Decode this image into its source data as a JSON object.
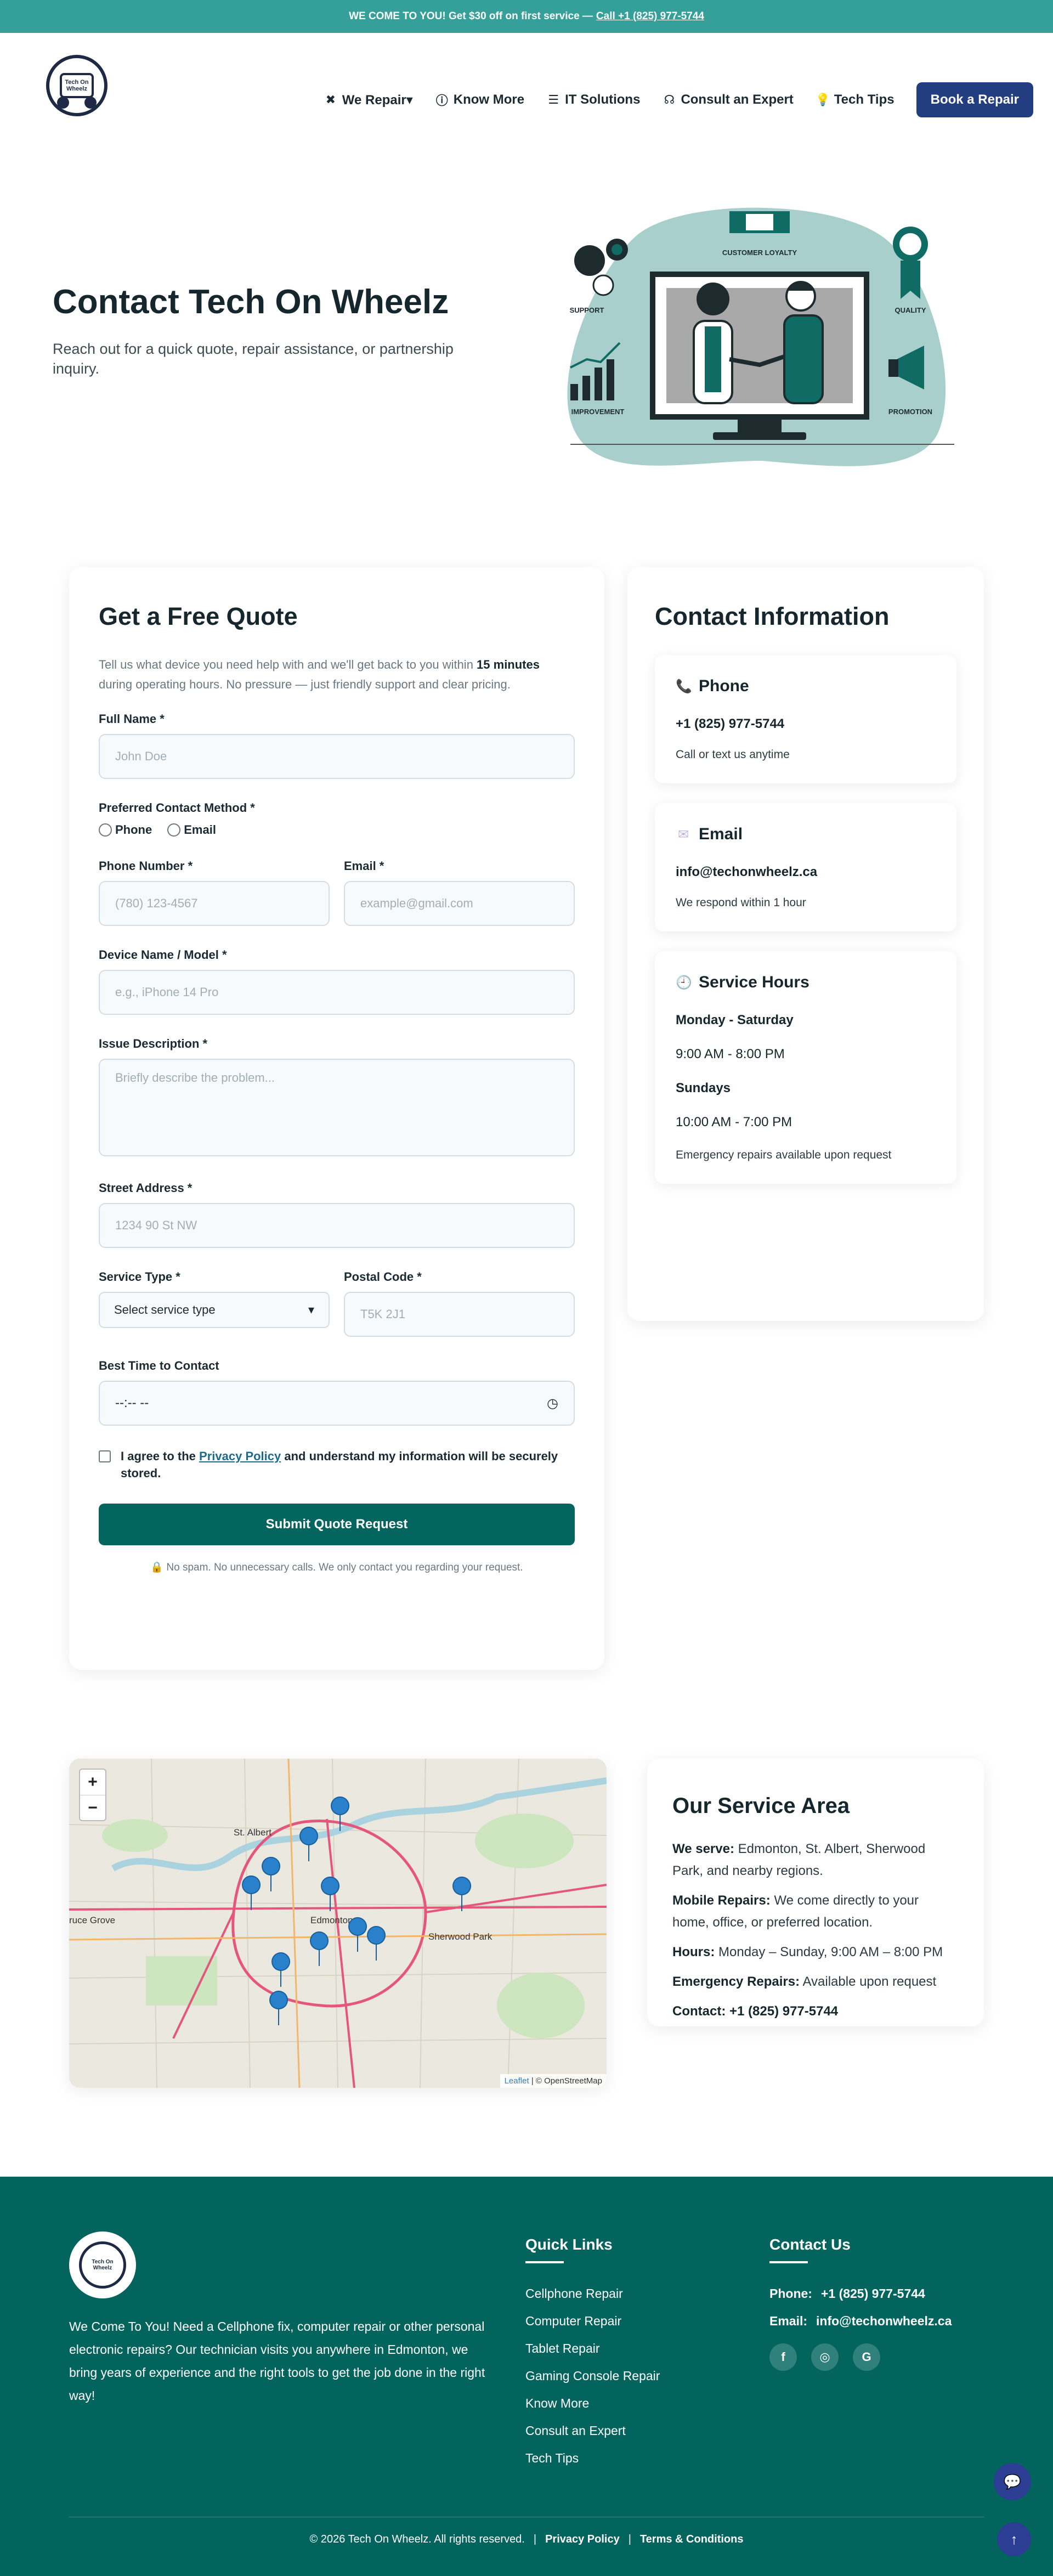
{
  "topbar": {
    "text": "WE COME TO YOU! Get $30 off on first service —",
    "link": "Call +1 (825) 977-5744"
  },
  "header": {
    "logo_text": "Tech On Wheelz",
    "nav": [
      {
        "label": "We Repair▾",
        "icon": "wrench-icon"
      },
      {
        "label": "Know More",
        "icon": "info-icon"
      },
      {
        "label": "IT Solutions",
        "icon": "server-icon"
      },
      {
        "label": "Consult an Expert",
        "icon": "headset-icon"
      },
      {
        "label": "Tech Tips",
        "icon": "lightbulb-icon"
      }
    ],
    "cta": "Book a Repair"
  },
  "hero": {
    "title": "Contact Tech On Wheelz",
    "subtitle": "Reach out for a quick quote, repair assistance, or partnership inquiry.",
    "art_labels": {
      "customer_loyalty": "CUSTOMER LOYALTY",
      "support": "SUPPORT",
      "quality": "QUALITY",
      "improvement": "IMPROVEMENT",
      "promotion": "PROMOTION"
    }
  },
  "quote": {
    "title": "Get a Free Quote",
    "intro_before": "Tell us what device you need help with and we'll get back to you within ",
    "intro_bold": "15 minutes",
    "intro_after": " during operating hours. No pressure — just friendly support and clear pricing.",
    "full_name_label": "Full Name *",
    "full_name_placeholder": "John Doe",
    "contact_method_label": "Preferred Contact Method *",
    "contact_phone": "Phone",
    "contact_email": "Email",
    "phone_label": "Phone Number *",
    "phone_placeholder": "(780) 123-4567",
    "email_label": "Email *",
    "email_placeholder": "example@gmail.com",
    "device_label": "Device Name / Model *",
    "device_placeholder": "e.g., iPhone 14 Pro",
    "issue_label": "Issue Description *",
    "issue_placeholder": "Briefly describe the problem...",
    "address_label": "Street Address *",
    "address_placeholder": "1234 90 St NW",
    "service_label": "Service Type *",
    "service_value": "Select service type",
    "postal_label": "Postal Code *",
    "postal_placeholder": "T5K 2J1",
    "best_time_label": "Best Time to Contact",
    "best_time_value": "--:-- --",
    "agree_before": "I agree to the ",
    "agree_link": "Privacy Policy",
    "agree_after": " and understand my information will be securely stored.",
    "submit": "Submit Quote Request",
    "note": "No spam. No unnecessary calls. We only contact you regarding your request."
  },
  "contact_info": {
    "title": "Contact Information",
    "phone_head": "Phone",
    "phone_value": "+1 (825) 977-5744",
    "phone_note": "Call or text us anytime",
    "email_head": "Email",
    "email_value": "info@techonwheelz.ca",
    "email_note": "We respond within 1 hour",
    "hours_head": "Service Hours",
    "weekday": "Monday - Saturday",
    "weekday_hours": "9:00 AM - 8:00 PM",
    "sunday": "Sundays",
    "sunday_hours": "10:00 AM - 7:00 PM",
    "hours_note": "Emergency repairs available upon request"
  },
  "map": {
    "zoom_in": "+",
    "zoom_out": "−",
    "attribution_link": "Leaflet",
    "attribution_rest": "| © OpenStreetMap",
    "labels": {
      "st_albert": "St. Albert",
      "edmonton": "Edmonton",
      "sherwood": "Sherwood Park",
      "spruce": "ruce Grove"
    }
  },
  "service_area": {
    "title": "Our Service Area",
    "serve_label": "We serve:",
    "serve_text": "Edmonton, St. Albert, Sherwood Park, and nearby regions.",
    "mobile_label": "Mobile Repairs:",
    "mobile_text": "We come directly to your home, office, or preferred location.",
    "hours_label": "Hours:",
    "hours_text": "Monday – Sunday, 9:00 AM – 8:00 PM",
    "emergency_label": "Emergency Repairs:",
    "emergency_text": "Available upon request",
    "contact_label": "Contact:",
    "contact_text": "+1 (825) 977-5744"
  },
  "footer": {
    "logo_text": "Tech On Wheelz",
    "about": "We Come To You! Need a Cellphone fix, computer repair or other personal electronic repairs? Our technician visits you anywhere in Edmonton, we bring years of experience and the right tools to get the job done in the right way!",
    "quick_links_title": "Quick Links",
    "quick_links": [
      "Cellphone Repair",
      "Computer Repair",
      "Tablet Repair",
      "Gaming Console Repair",
      "Know More",
      "Consult an Expert",
      "Tech Tips"
    ],
    "contact_title": "Contact Us",
    "phone_label": "Phone:",
    "phone_value": "+1 (825) 977-5744",
    "email_label": "Email:",
    "email_value": "info@techonwheelz.ca",
    "copyright": "© 2026 Tech On Wheelz. All rights reserved.",
    "privacy": "Privacy Policy",
    "terms": "Terms & Conditions"
  },
  "colors": {
    "teal_topbar": "#35a09a",
    "footer_teal": "#03645e",
    "cta_blue": "#233e80",
    "submit": "#04645e"
  }
}
